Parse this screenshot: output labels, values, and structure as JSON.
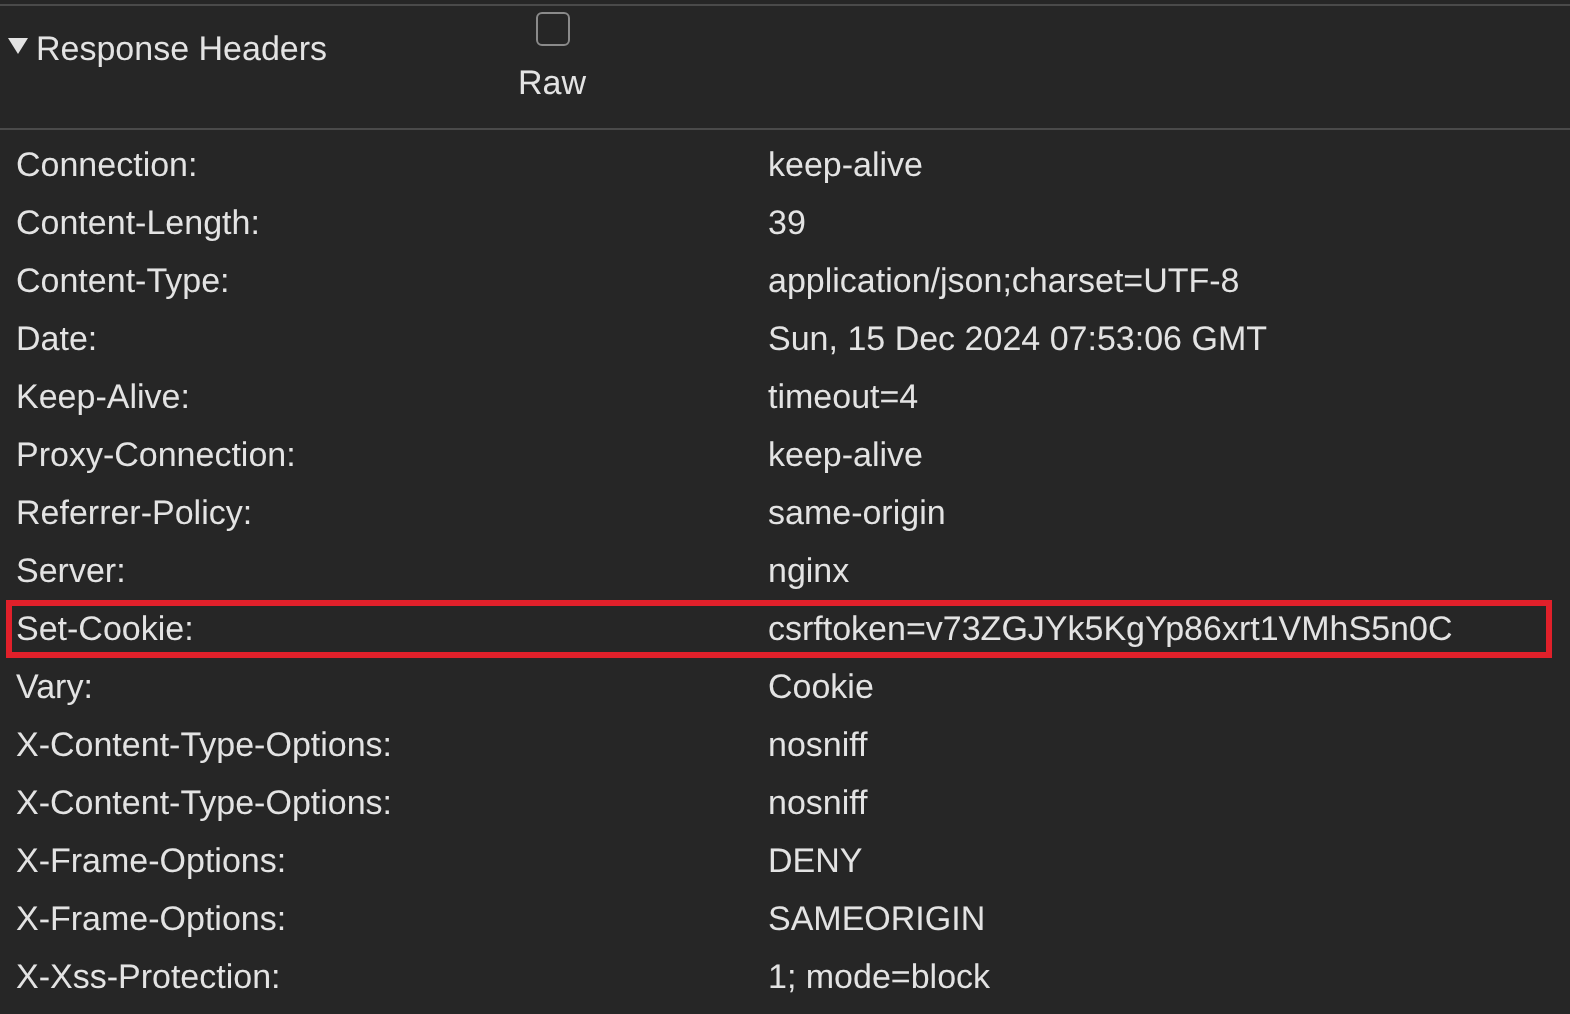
{
  "section": {
    "title": "Response Headers",
    "expanded": true,
    "raw": {
      "label": "Raw",
      "checked": false
    }
  },
  "headers": [
    {
      "name": "Connection:",
      "value": "keep-alive",
      "highlighted": false
    },
    {
      "name": "Content-Length:",
      "value": "39",
      "highlighted": false
    },
    {
      "name": "Content-Type:",
      "value": "application/json;charset=UTF-8",
      "highlighted": false
    },
    {
      "name": "Date:",
      "value": "Sun, 15 Dec 2024 07:53:06 GMT",
      "highlighted": false
    },
    {
      "name": "Keep-Alive:",
      "value": "timeout=4",
      "highlighted": false
    },
    {
      "name": "Proxy-Connection:",
      "value": "keep-alive",
      "highlighted": false
    },
    {
      "name": "Referrer-Policy:",
      "value": "same-origin",
      "highlighted": false
    },
    {
      "name": "Server:",
      "value": "nginx",
      "highlighted": false
    },
    {
      "name": "Set-Cookie:",
      "value": "csrftoken=v73ZGJYk5KgYp86xrt1VMhS5n0C",
      "highlighted": true
    },
    {
      "name": "Vary:",
      "value": "Cookie",
      "highlighted": false
    },
    {
      "name": "X-Content-Type-Options:",
      "value": "nosniff",
      "highlighted": false
    },
    {
      "name": "X-Content-Type-Options:",
      "value": "nosniff",
      "highlighted": false
    },
    {
      "name": "X-Frame-Options:",
      "value": "DENY",
      "highlighted": false
    },
    {
      "name": "X-Frame-Options:",
      "value": "SAMEORIGIN",
      "highlighted": false
    },
    {
      "name": "X-Xss-Protection:",
      "value": "1; mode=block",
      "highlighted": false
    }
  ]
}
